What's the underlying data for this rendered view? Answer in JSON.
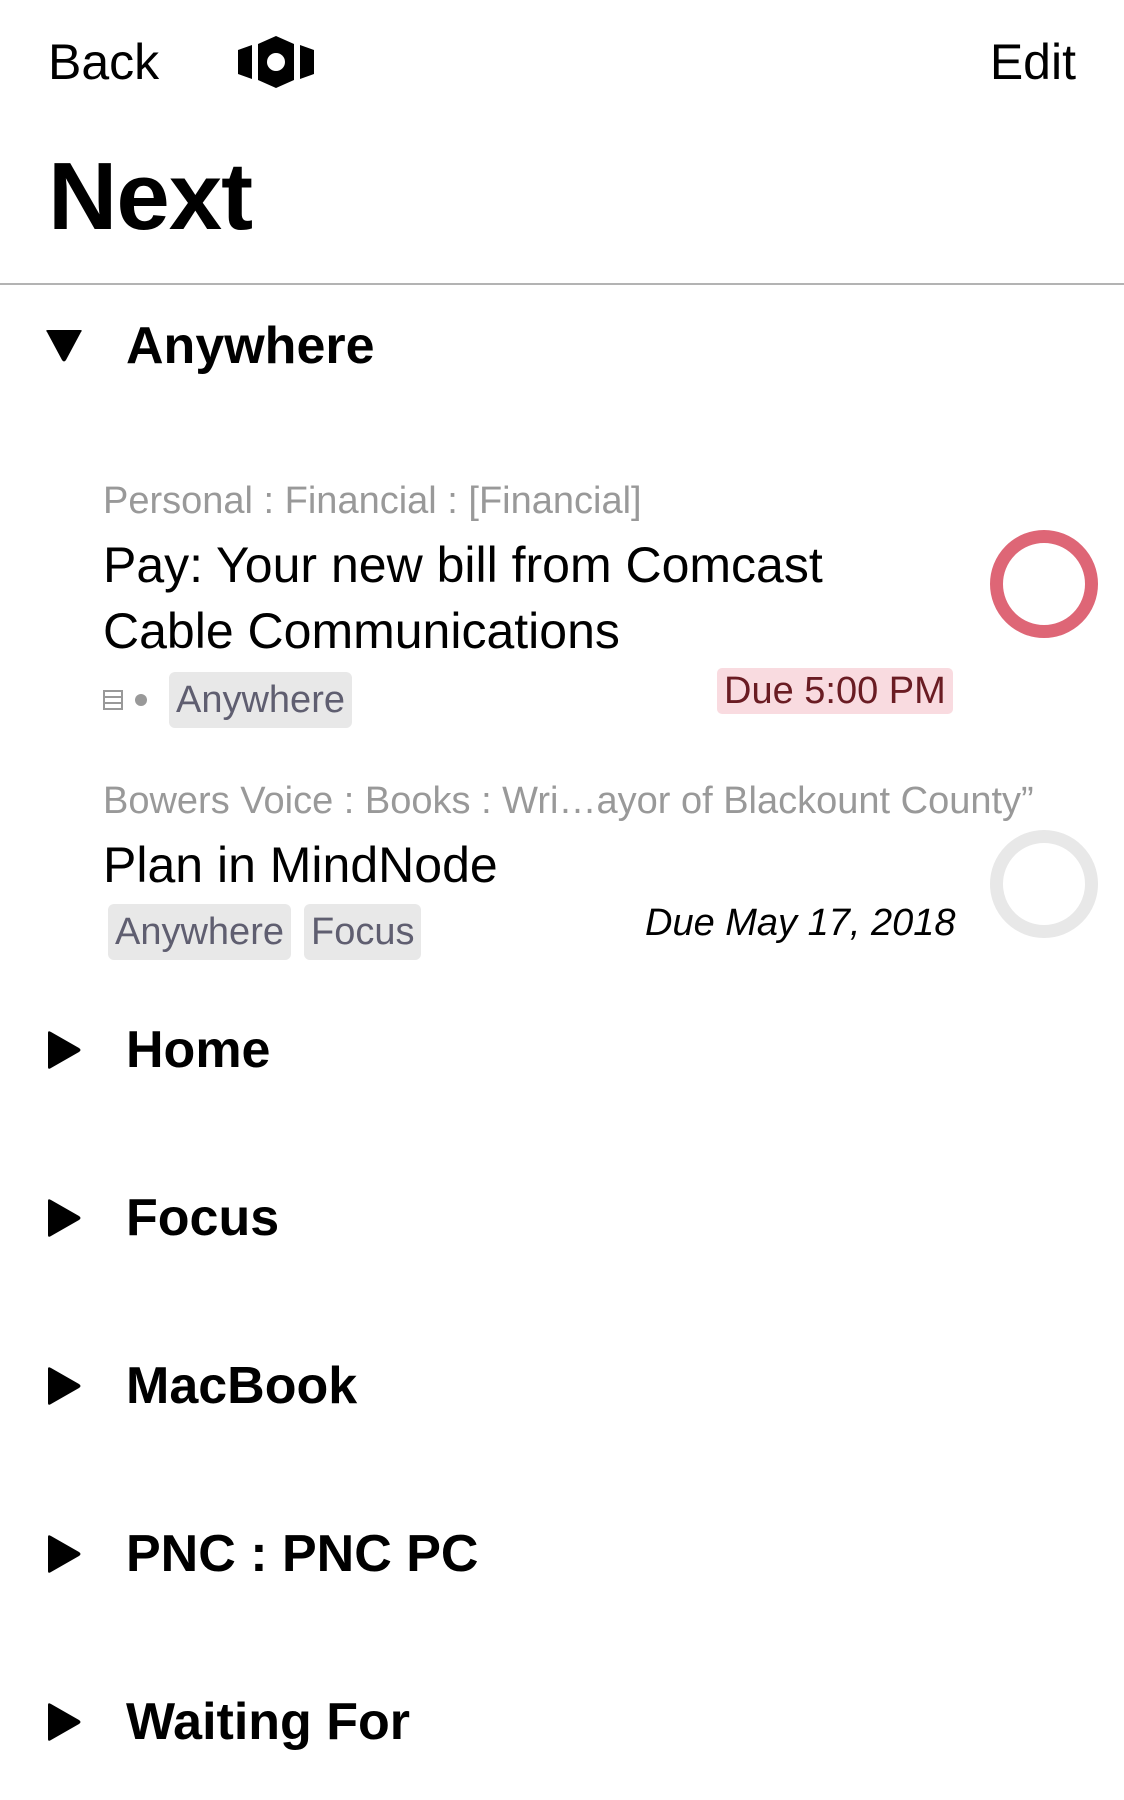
{
  "nav": {
    "back_label": "Back",
    "logo_icon": "omnifocus-logo-icon",
    "edit_label": "Edit"
  },
  "page": {
    "title": "Next"
  },
  "colors": {
    "overdue_accent": "#de6676",
    "due_badge_bg": "#f9dbe0",
    "due_badge_text": "#6a1c23",
    "tag_bg": "#e8e8e8",
    "tag_text": "#5f5e70",
    "muted_text": "#999999",
    "divider": "#b3b3b3"
  },
  "sections": [
    {
      "label": "Anywhere",
      "expanded": true,
      "icon": "triangle-down-icon",
      "tasks": [
        {
          "project": "Personal : Financial : [Financial]",
          "title_lines": [
            "Pay: Your new bill from Comcast",
            "Cable Communications"
          ],
          "has_note": true,
          "tags": [
            "Anywhere"
          ],
          "due": "Due 5:00 PM",
          "due_style": "overdue",
          "completed": false
        },
        {
          "project": "Bowers Voice : Books : Wri…ayor of Blackount County”",
          "title_lines": [
            "Plan in MindNode"
          ],
          "has_note": false,
          "tags": [
            "Anywhere",
            "Focus"
          ],
          "due": "Due May 17, 2018",
          "due_style": "normal",
          "completed": false
        }
      ]
    },
    {
      "label": "Home",
      "expanded": false,
      "icon": "triangle-right-icon"
    },
    {
      "label": "Focus",
      "expanded": false,
      "icon": "triangle-right-icon"
    },
    {
      "label": "MacBook",
      "expanded": false,
      "icon": "triangle-right-icon"
    },
    {
      "label": "PNC : PNC PC",
      "expanded": false,
      "icon": "triangle-right-icon"
    },
    {
      "label": "Waiting For",
      "expanded": false,
      "icon": "triangle-right-icon"
    }
  ]
}
